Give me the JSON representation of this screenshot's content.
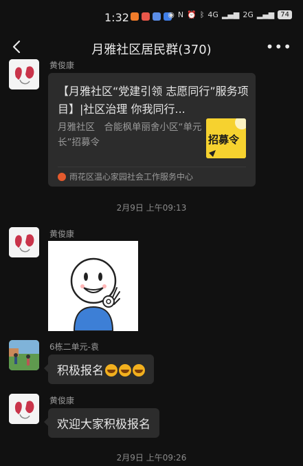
{
  "status_bar": {
    "time": "1:32",
    "network_left": "4G",
    "network_right": "2G",
    "battery": "74",
    "app_notification_colors": [
      "#f07c2a",
      "#e8574a",
      "#5a8de6",
      "#3f7ee8"
    ]
  },
  "header": {
    "title": "月雅社区居民群(370)",
    "back_icon": "chevron-left-icon",
    "more_icon": "more-dots-icon",
    "more_label": "•••"
  },
  "messages": [
    {
      "type": "link_card",
      "sender": "黄俊康",
      "card": {
        "title": "【月雅社区“党建引领 志愿同行”服务项目】|社区治理 你我同行...",
        "description": "月雅社区　合能枫单丽舍小区“单元长”招募令",
        "thumbnail_text": "招募令",
        "source": "雨花区温心家园社会工作服务中心"
      }
    },
    {
      "type": "timestamp",
      "text": "2月9日 上午09:13"
    },
    {
      "type": "sticker",
      "sender": "黄俊康",
      "sticker": "ok-gesture-cartoon"
    },
    {
      "type": "text",
      "sender": "6栋二单元-袁",
      "text": "积极报名"
    },
    {
      "type": "text",
      "sender": "黄俊康",
      "text": "欢迎大家积极报名"
    },
    {
      "type": "timestamp",
      "text": "2月9日 上午09:26"
    }
  ],
  "colors": {
    "background": "#111111",
    "bubble": "#2c2c2c",
    "secondary_text": "#9a9a9a",
    "thumbnail_yellow": "#f6d22f"
  }
}
